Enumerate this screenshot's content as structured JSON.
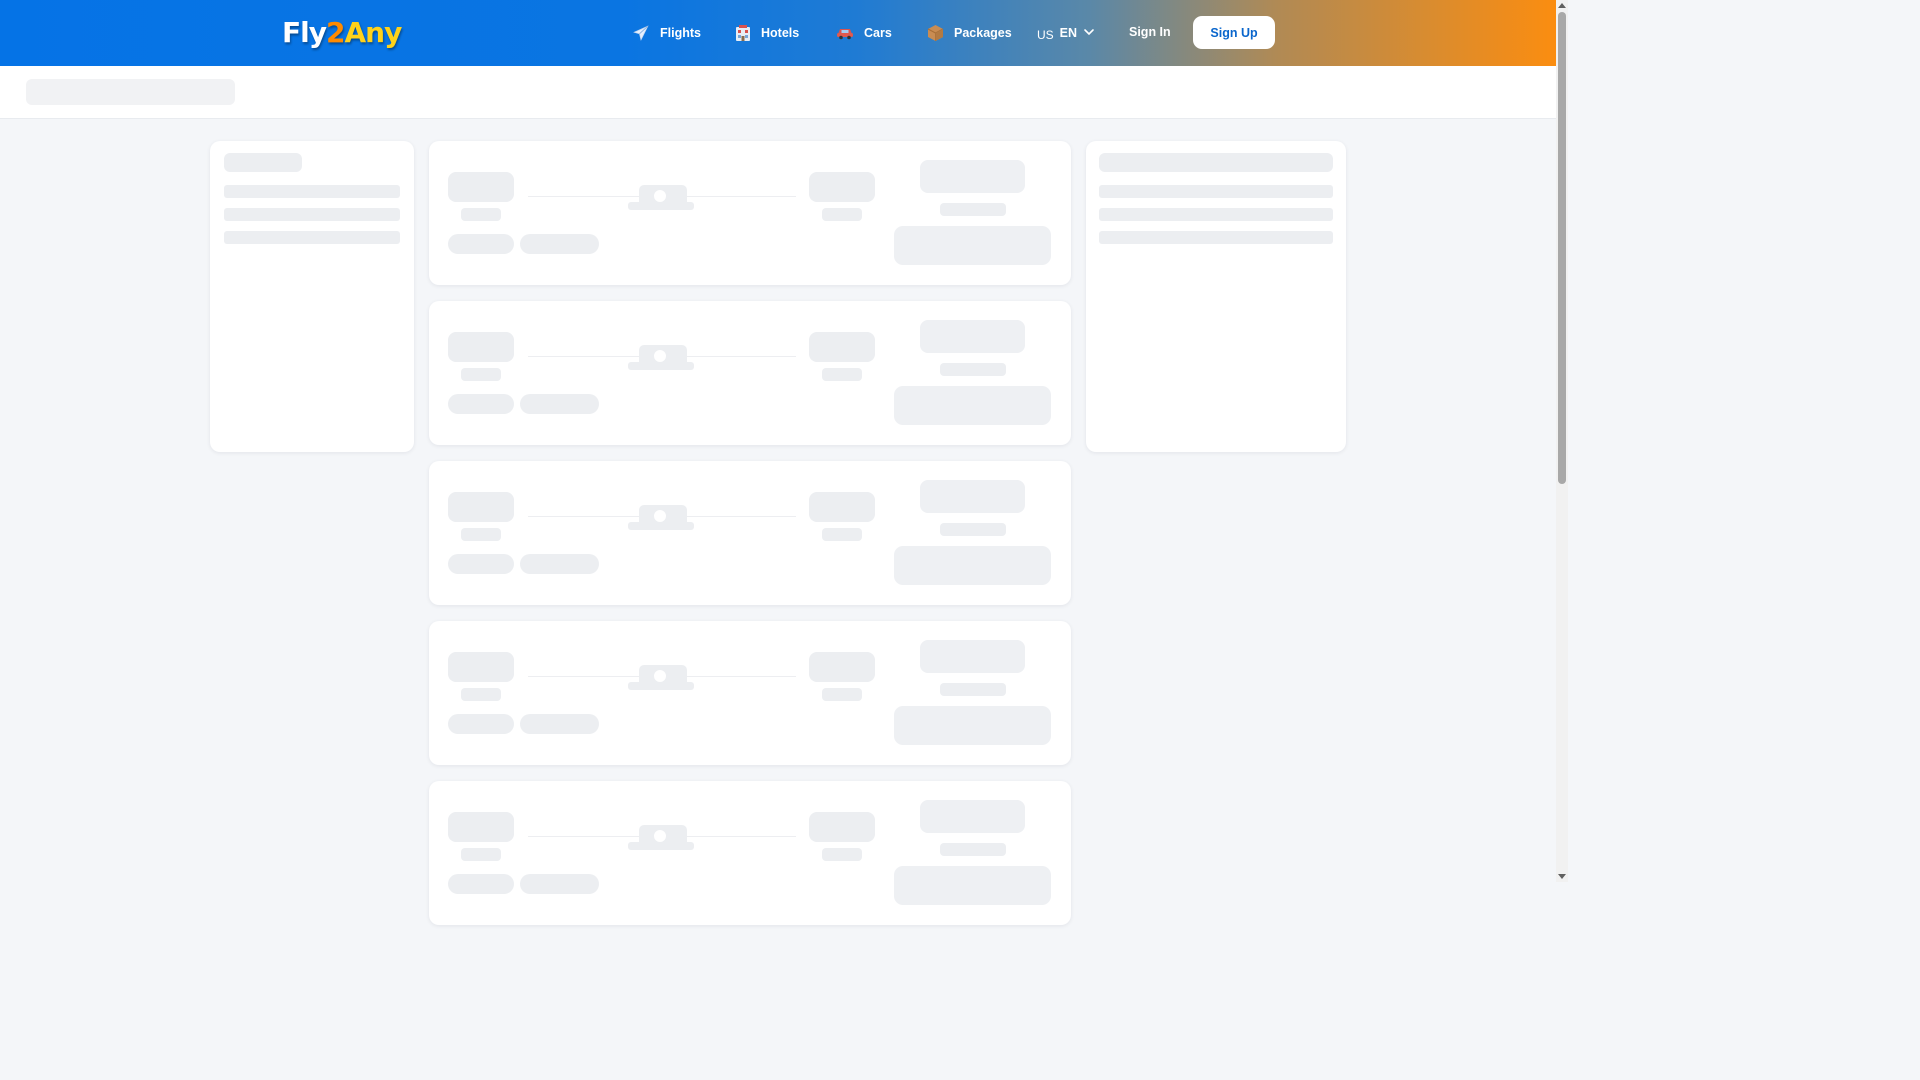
{
  "header": {
    "logo": {
      "part1": "Fly",
      "part2": "2",
      "part3": "Any"
    },
    "nav": [
      {
        "label": "Flights",
        "icon": "airplane-icon"
      },
      {
        "label": "Hotels",
        "icon": "hotel-building-icon"
      },
      {
        "label": "Cars",
        "icon": "car-icon"
      },
      {
        "label": "Packages",
        "icon": "package-box-icon"
      }
    ],
    "locale": {
      "country": "US",
      "language": "EN",
      "icon": "chevron-down-icon"
    },
    "sign_in": "Sign In",
    "sign_up": "Sign Up"
  },
  "page_state": "loading",
  "colors": {
    "header_start": "#0573e6",
    "header_end": "#fb8d10",
    "signup_text": "#0a66cc",
    "page_bg": "#f4f6f9",
    "skeleton": "#eceef1"
  }
}
